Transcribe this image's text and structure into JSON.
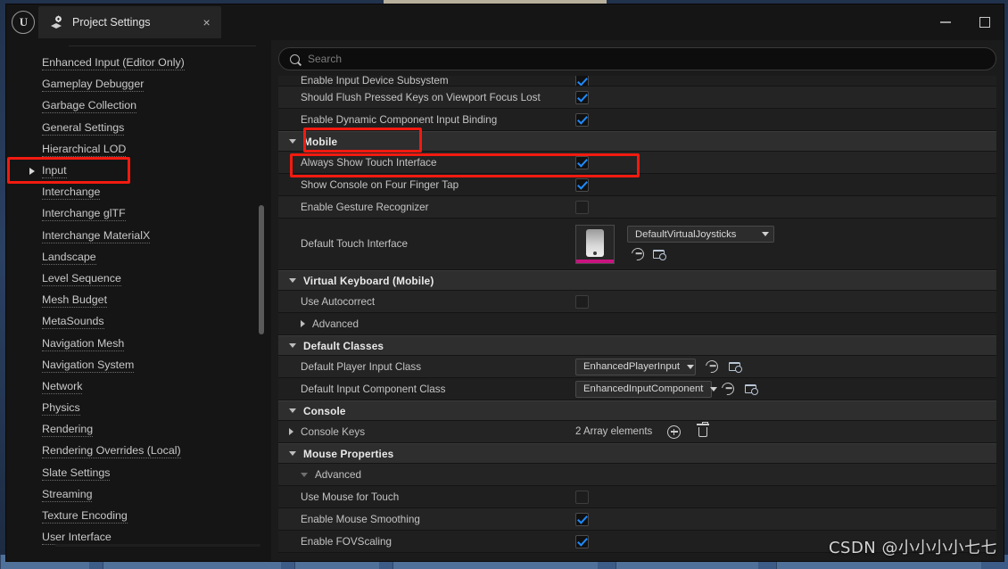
{
  "window": {
    "app_logo": "unreal-engine-logo",
    "tab_title": "Project Settings",
    "tab_close": "×",
    "minimize": "minimize",
    "maximize": "maximize"
  },
  "search": {
    "placeholder": "Search",
    "value": "",
    "icon": "search-icon"
  },
  "sidebar": {
    "items": [
      {
        "label": "Enhanced Input (Editor Only)",
        "expandable": false,
        "selected": false
      },
      {
        "label": "Gameplay Debugger",
        "expandable": false,
        "selected": false
      },
      {
        "label": "Garbage Collection",
        "expandable": false,
        "selected": false
      },
      {
        "label": "General Settings",
        "expandable": false,
        "selected": false
      },
      {
        "label": "Hierarchical LOD",
        "expandable": false,
        "selected": false
      },
      {
        "label": "Input",
        "expandable": true,
        "selected": true
      },
      {
        "label": "Interchange",
        "expandable": false,
        "selected": false
      },
      {
        "label": "Interchange glTF",
        "expandable": false,
        "selected": false
      },
      {
        "label": "Interchange MaterialX",
        "expandable": false,
        "selected": false
      },
      {
        "label": "Landscape",
        "expandable": false,
        "selected": false
      },
      {
        "label": "Level Sequence",
        "expandable": false,
        "selected": false
      },
      {
        "label": "Mesh Budget",
        "expandable": false,
        "selected": false
      },
      {
        "label": "MetaSounds",
        "expandable": false,
        "selected": false
      },
      {
        "label": "Navigation Mesh",
        "expandable": false,
        "selected": false
      },
      {
        "label": "Navigation System",
        "expandable": false,
        "selected": false
      },
      {
        "label": "Network",
        "expandable": false,
        "selected": false
      },
      {
        "label": "Physics",
        "expandable": false,
        "selected": false
      },
      {
        "label": "Rendering",
        "expandable": false,
        "selected": false
      },
      {
        "label": "Rendering Overrides (Local)",
        "expandable": false,
        "selected": false
      },
      {
        "label": "Slate Settings",
        "expandable": false,
        "selected": false
      },
      {
        "label": "Streaming",
        "expandable": false,
        "selected": false
      },
      {
        "label": "Texture Encoding",
        "expandable": false,
        "selected": false
      },
      {
        "label": "User Interface",
        "expandable": false,
        "selected": false
      }
    ]
  },
  "properties": {
    "r0": {
      "label": "Enable Input Device Subsystem",
      "value": "checked"
    },
    "r1": {
      "label": "Should Flush Pressed Keys on Viewport Focus Lost",
      "value": "checked"
    },
    "r2": {
      "label": "Enable Dynamic Component Input Binding",
      "value": "checked"
    },
    "s_mobile": {
      "label": "Mobile"
    },
    "r3": {
      "label": "Always Show Touch Interface",
      "value": "checked"
    },
    "r4": {
      "label": "Show Console on Four Finger Tap",
      "value": "checked"
    },
    "r5": {
      "label": "Enable Gesture Recognizer",
      "value": "unchecked"
    },
    "r6": {
      "label": "Default Touch Interface",
      "dropdown": "DefaultVirtualJoysticks",
      "thumbnail": "virtual-joysticks-thumbnail",
      "reset_icon": "reset-to-default-icon",
      "browse_icon": "browse-to-asset-icon"
    },
    "s_vkb": {
      "label": "Virtual Keyboard (Mobile)"
    },
    "r7": {
      "label": "Use Autocorrect",
      "value": "unchecked"
    },
    "r8": {
      "label": "Advanced"
    },
    "s_defclass": {
      "label": "Default Classes"
    },
    "r9": {
      "label": "Default Player Input Class",
      "dropdown": "EnhancedPlayerInput",
      "reset_icon": "reset-to-default-icon",
      "browse_icon": "browse-to-asset-icon"
    },
    "r10": {
      "label": "Default Input Component Class",
      "dropdown": "EnhancedInputComponent",
      "reset_icon": "reset-to-default-icon",
      "browse_icon": "browse-to-asset-icon"
    },
    "s_console": {
      "label": "Console"
    },
    "r11": {
      "label": "Console Keys",
      "array_text": "2 Array elements",
      "add_icon": "add-element-icon",
      "delete_icon": "delete-all-elements-icon"
    },
    "s_mouse": {
      "label": "Mouse Properties"
    },
    "r12": {
      "label": "Advanced"
    },
    "r13": {
      "label": "Use Mouse for Touch",
      "value": "unchecked"
    },
    "r14": {
      "label": "Enable Mouse Smoothing",
      "value": "checked"
    },
    "r15": {
      "label": "Enable FOVScaling",
      "value": "checked"
    }
  },
  "annotations": {
    "highlight_color": "#f31a10",
    "boxes": [
      "input-sidebar-item",
      "mobile-section-header",
      "always-show-touch-interface-row"
    ]
  },
  "watermark": {
    "text": "CSDN @小小小小七七"
  }
}
